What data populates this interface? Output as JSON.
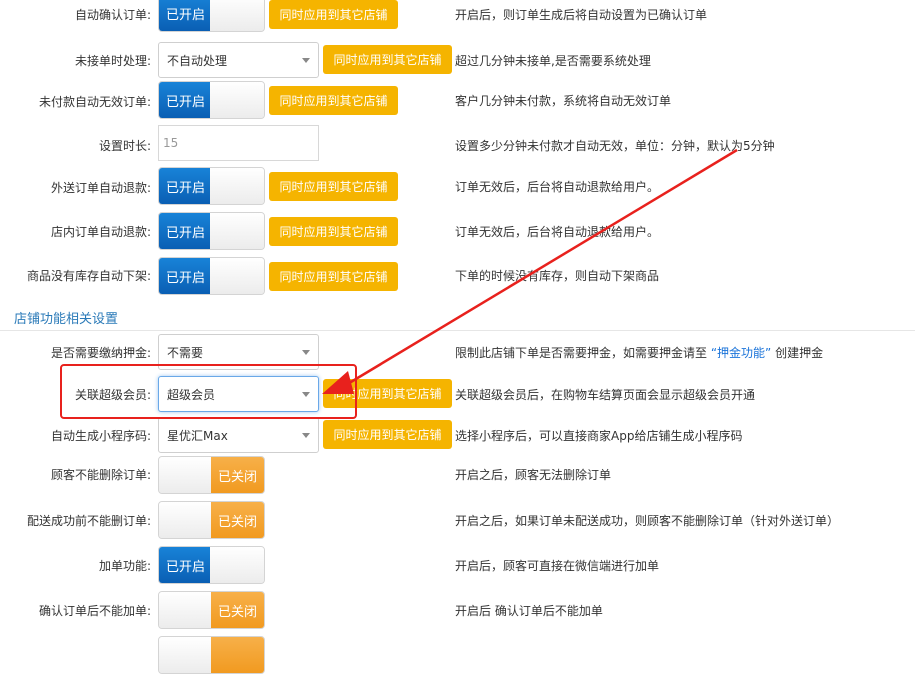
{
  "apply_label": "同时应用到其它店铺",
  "toggle_on": "已开启",
  "toggle_off": "已关闭",
  "rows": {
    "auto_confirm": {
      "label": "自动确认订单:",
      "desc": "开启后，则订单生成后将自动设置为已确认订单"
    },
    "unaccepted": {
      "label": "未接单时处理:",
      "value": "不自动处理",
      "desc": "超过几分钟未接单,是否需要系统处理"
    },
    "unpaid_invalid": {
      "label": "未付款自动无效订单:",
      "desc": "客户几分钟未付款，系统将自动无效订单"
    },
    "time_setting": {
      "label": "设置时长:",
      "placeholder": "15",
      "desc": "设置多少分钟未付款才自动无效，单位：分钟，默认为5分钟"
    },
    "delivery_refund": {
      "label": "外送订单自动退款:",
      "desc": "订单无效后，后台将自动退款给用户。"
    },
    "instore_refund": {
      "label": "店内订单自动退款:",
      "desc": "订单无效后，后台将自动退款给用户。"
    },
    "no_stock": {
      "label": "商品没有库存自动下架:",
      "desc": "下单的时候没有库存，则自动下架商品"
    },
    "deposit": {
      "label": "是否需要缴纳押金:",
      "value": "不需要",
      "desc_pre": "限制此店铺下单是否需要押金，如需要押金请至",
      "desc_link": "“押金功能”",
      "desc_post": "创建押金"
    },
    "super_member": {
      "label": "关联超级会员:",
      "value": "超级会员",
      "desc": "关联超级会员后，在购物车结算页面会显示超级会员开通"
    },
    "mini_program": {
      "label": "自动生成小程序码:",
      "value": "星优汇Max",
      "desc": "选择小程序后，可以直接商家App给店铺生成小程序码"
    },
    "no_delete": {
      "label": "顾客不能删除订单:",
      "desc": "开启之后，顾客无法删除订单"
    },
    "no_delete_before": {
      "label": "配送成功前不能删订单:",
      "desc": "开启之后，如果订单未配送成功，则顾客不能删除订单（针对外送订单）"
    },
    "add_order": {
      "label": "加单功能:",
      "desc": "开启后，顾客可直接在微信端进行加单"
    },
    "no_add_after": {
      "label": "确认订单后不能加单:",
      "desc": "开启后 确认订单后不能加单"
    }
  },
  "section": {
    "title": "店铺功能相关设置"
  },
  "colors": {
    "accent_blue": "#0a5fb4",
    "button_yellow": "#f5b400",
    "off_orange": "#f19a20",
    "annotation_red": "#e8211d"
  }
}
